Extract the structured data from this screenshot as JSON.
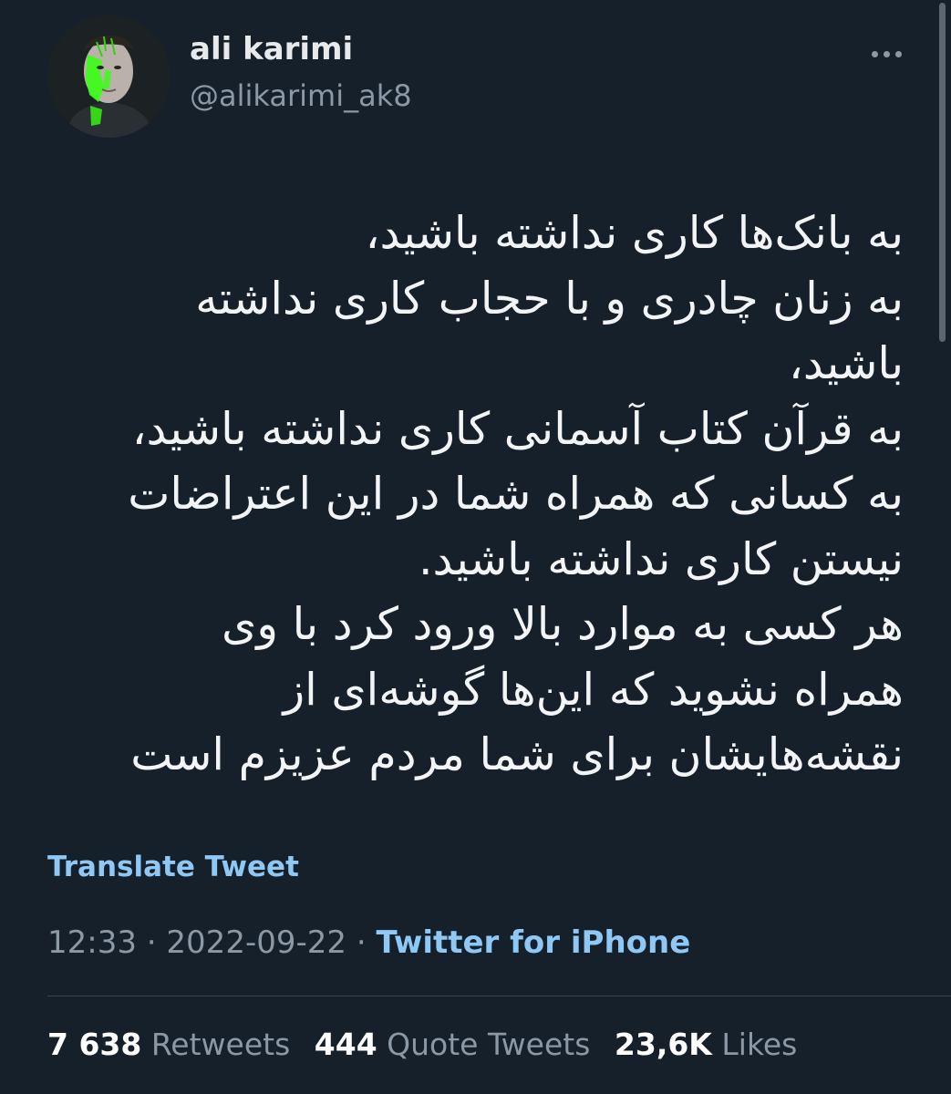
{
  "user": {
    "name": "ali karimi",
    "handle": "@alikarimi_ak8"
  },
  "tweet": {
    "lines": [
      "به بانک‌ها کاری نداشته باشید،",
      "به زنان چادری و با حجاب کاری نداشته",
      "باشید،",
      "به قرآن کتاب آسمانی کاری نداشته باشید،",
      "به کسانی که همراه شما در این اعتراضات",
      "نیستن کاری نداشته باشید.",
      "هر کسی به موارد بالا ورود کرد با وی",
      "همراه نشوید که این‌ها گوشه‌ای از",
      "نقشه‌هایشان برای شما مردم عزیزم است"
    ],
    "translate_label": "Translate Tweet",
    "time": "12:33",
    "date": "2022-09-22",
    "separator": "·",
    "source": "Twitter for iPhone"
  },
  "stats": {
    "retweets": {
      "count": "7 638",
      "label": "Retweets"
    },
    "quotes": {
      "count": "444",
      "label": "Quote Tweets"
    },
    "likes": {
      "count": "23,6K",
      "label": "Likes"
    }
  },
  "icons": {
    "more": "more-dots-icon",
    "avatar": "profile-photo"
  },
  "colors": {
    "background": "#15202b",
    "link": "#8fc8f4",
    "secondary_text": "#8b98a5",
    "avatar_accent": "#39ff14"
  }
}
